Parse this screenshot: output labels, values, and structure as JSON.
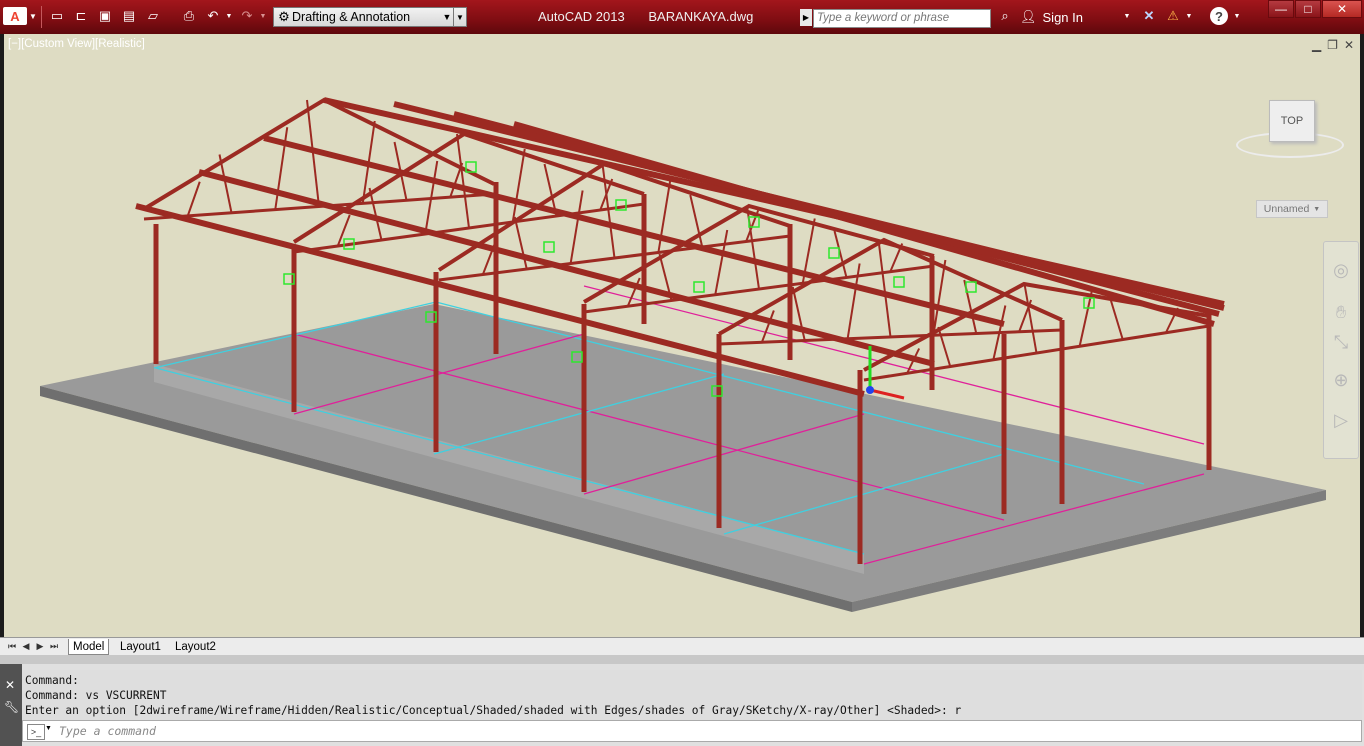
{
  "app": {
    "product": "AutoCAD 2013",
    "filename": "BARANKAYA.dwg"
  },
  "toolbar": {
    "workspace": "Drafting & Annotation",
    "search_placeholder": "Type a keyword or phrase",
    "sign_in": "Sign In"
  },
  "viewport": {
    "label": "[−][Custom View][Realistic]",
    "viewcube_face": "TOP",
    "ucs_name": "Unnamed"
  },
  "tabs": [
    {
      "label": "Model"
    },
    {
      "label": "Layout1"
    },
    {
      "label": "Layout2"
    }
  ],
  "command": {
    "history": [
      "Command:",
      "Command: vs VSCURRENT",
      "Enter an option [2dwireframe/Wireframe/Hidden/Realistic/Conceptual/Shaded/shaded with Edges/shades of Gray/SKetchy/X-ray/Other] <Shaded>: r"
    ],
    "input_placeholder": "Type a command"
  },
  "colors": {
    "title_bar": "#8e1015",
    "viewport_bg": "#dedcc3",
    "steel": "#9c2a22",
    "slab": "#8c8c8c"
  }
}
